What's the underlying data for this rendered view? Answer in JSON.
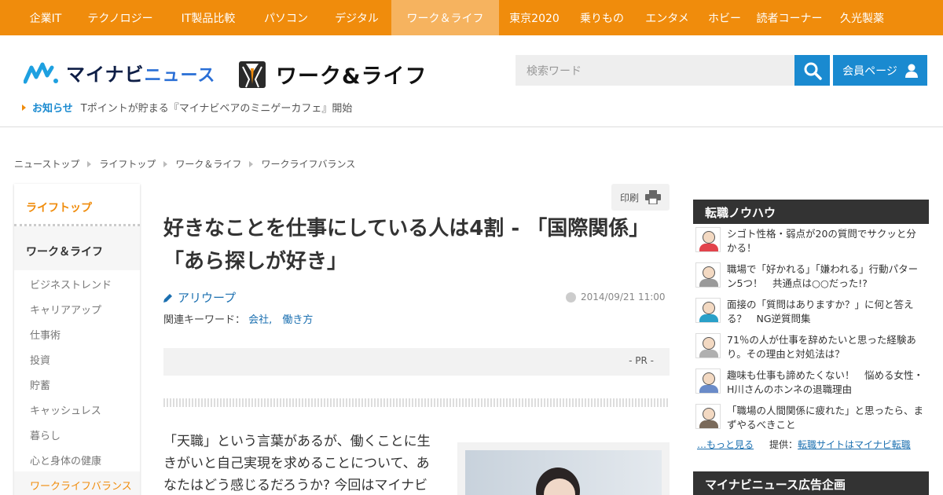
{
  "topnav": {
    "items": [
      {
        "label": "企業IT"
      },
      {
        "label": "テクノロジー"
      },
      {
        "label": "IT製品比較"
      },
      {
        "label": "パソコン"
      },
      {
        "label": "デジタル"
      },
      {
        "label": "ワーク＆ライフ",
        "active": true
      },
      {
        "label": "東京2020"
      },
      {
        "label": "乗りもの"
      },
      {
        "label": "エンタメ"
      },
      {
        "label": "ホビー"
      },
      {
        "label": "読者コーナー"
      },
      {
        "label": "久光製薬"
      }
    ]
  },
  "header": {
    "logo_main": "マイナビ",
    "logo_sub": "ニュース",
    "section_title": "ワーク&ライフ",
    "search_placeholder": "検索ワード",
    "member_label": "会員ページ",
    "notice_label": "お知らせ",
    "notice_text": "Tポイントが貯まる『マイナビベアのミニゲーカフェ』開始"
  },
  "breadcrumb": [
    "ニューストップ",
    "ライフトップ",
    "ワーク＆ライフ",
    "ワークライフバランス"
  ],
  "leftnav": {
    "top": "ライフトップ",
    "category": "ワーク＆ライフ",
    "items": [
      "ビジネストレンド",
      "キャリアアップ",
      "仕事術",
      "投資",
      "貯蓄",
      "キャッシュレス",
      "暮らし",
      "心と身体の健康",
      "ワークライフバランス"
    ],
    "active_item": "ワークライフバランス"
  },
  "article": {
    "print_label": "印刷",
    "title": "好きなことを仕事にしている人は4割 - 「国際関係」「あら探しが好き」",
    "author": "アリウープ",
    "date": "2014/09/21 11:00",
    "keywords_label": "関連キーワード：",
    "keywords": [
      "会社",
      "働き方"
    ],
    "pr_label": "- PR -",
    "body": "「天職」という言葉があるが、働くことに生きがいと自己実現を求めることについて、あなたはどう感じるだろうか? 今回はマイナビニュース"
  },
  "sidebar": {
    "tenshoku_title": "転職ノウハウ",
    "tenshoku_items": [
      {
        "text": "シゴト性格・弱点が20の質問でサクッと分かる！",
        "color": "#e2434b"
      },
      {
        "text": "職場で「好かれる」「嫌われる」行動パターン5つ！　共通点は○○だった!?",
        "color": "#9a9a9a"
      },
      {
        "text": "面接の「質問はありますか？」に何と答える？　NG逆質問集",
        "color": "#2aa0c8"
      },
      {
        "text": "71％の人が仕事を辞めたいと思った経験あり。その理由と対処法は？",
        "color": "#b0b0b0"
      },
      {
        "text": "趣味も仕事も諦めたくない！　悩める女性・H川さんのホンネの退職理由",
        "color": "#6a8bc8"
      },
      {
        "text": "「職場の人間関係に疲れた」と思ったら、まずやるべきこと",
        "color": "#7a6a5a"
      }
    ],
    "more_label": "…もっと見る",
    "provider_label": "提供：",
    "provider_link": "転職サイトはマイナビ転職",
    "ad_title": "マイナビニュース広告企画"
  },
  "colors": {
    "nav_orange": "#f08c0c",
    "nav_active": "#f6b35f",
    "link_blue": "#1a6fb0",
    "button_blue": "#1a8ad0"
  }
}
